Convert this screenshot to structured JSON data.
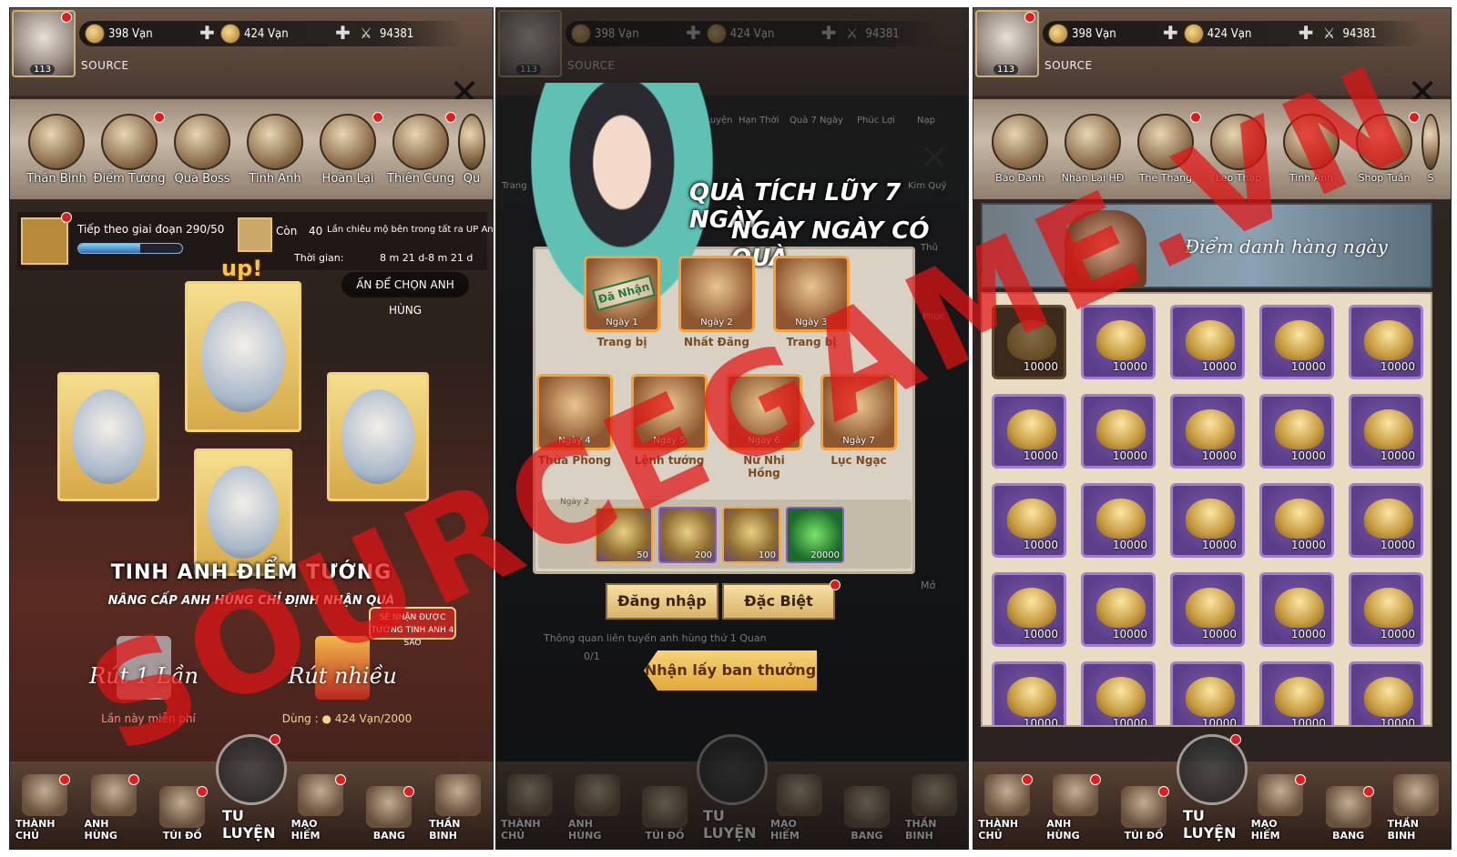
{
  "panels": {
    "common": {
      "resources": [
        {
          "value": "398 Vạn",
          "icon": "copper-coin-icon"
        },
        {
          "value": "424 Vạn",
          "icon": "gold-ingot-icon"
        },
        {
          "value": "94381",
          "icon": "crossed-swords-icon"
        }
      ],
      "level": "113",
      "source_label": "SOURCE",
      "bottom_nav": [
        "THÀNH CHỦ",
        "ANH HÙNG",
        "TÚI ĐỒ",
        "TU LUYỆN",
        "MẠO HIỂM",
        "BANG",
        "THẦN BINH"
      ]
    },
    "p1": {
      "tabs": [
        "Thần Binh",
        "Điểm Tướng",
        "Quà Boss",
        "Tinh Anh",
        "Hoàn Lại",
        "Thiên Cung",
        "Qu"
      ],
      "next_stage": "Tiếp theo giai đoạn 290/50",
      "remaining_label": "Còn",
      "remaining_value": "40",
      "remaining_desc": "Lần chiêu mộ bên trong tất ra UP Anh hùng",
      "time_label": "Thời gian:",
      "time_value": "8 m 21 d-8 m 21 d",
      "choose_hero": "ẤN ĐỂ CHỌN ANH HÙNG",
      "up_label": "up!",
      "title": "TINH ANH ĐIỂM TƯỚNG",
      "subtitle": "NÂNG CẤP ANH HÙNG CHỈ ĐỊNH NHẬN QUÀ",
      "badge": "SẼ NHẬN ĐƯỢC TƯỚNG TINH ANH 4 SAO",
      "draw_once": "Rút 1 Lần",
      "draw_once_sub": "Lần này miễn phí",
      "draw_many": "Rút nhiều",
      "draw_many_sub_label": "Dùng :",
      "draw_many_sub_value": "424 Vạn/2000",
      "progress": 0.6
    },
    "p2": {
      "title_line1": "QUÀ TÍCH LŨY 7 NGÀY",
      "title_line2": "NGÀY NGÀY CÓ QUÀ",
      "received_stamp": "Đã Nhận",
      "days": [
        {
          "day": "Ngày 1",
          "name": "Trang bị"
        },
        {
          "day": "Ngày 2",
          "name": "Nhất Đăng"
        },
        {
          "day": "Ngày 3",
          "name": "Trang bị"
        },
        {
          "day": "Ngày 4",
          "name": "Thừa Phong"
        },
        {
          "day": "Ngày 5",
          "name": "Lệnh tướng"
        },
        {
          "day": "Ngày 6",
          "name": "Nữ Nhi Hồng"
        },
        {
          "day": "Ngày 7",
          "name": "Lục Ngạc"
        }
      ],
      "tray_label": "Ngày 2",
      "tray_items": [
        "50",
        "200",
        "100",
        "20000"
      ],
      "btn_login": "Đăng nhập",
      "btn_special": "Đặc Biệt",
      "claim": "Nhận lấy ban thưởng",
      "ghost_quest": "Thông quan liên tuyến anh hùng thứ 1 Quan",
      "ghost_progress": "0/1",
      "ghost_mo": "Mở",
      "side_labels": [
        "Lịch Luyện",
        "Hạn Thời",
        "Quà 7 Ngày",
        "Phúc Lợi",
        "Nạp",
        "Kim Quỹ",
        "Trang",
        "Phúc",
        "Thủ"
      ]
    },
    "p3": {
      "tabs": [
        "Báo Danh",
        "Nhận Lại HĐ",
        "Thẻ Tháng",
        "Leo Tháp",
        "Tinh Anh",
        "Shop Tuần",
        "S"
      ],
      "banner": "Điểm danh hàng ngày",
      "cell_amount": "10000"
    }
  },
  "watermark": "SOURCEGAME.VN",
  "colors": {
    "accent_gold": "#f6a23c",
    "badge_red": "#e01d1d",
    "watermark": "#e11414",
    "cell_purple": "#a37bd3"
  }
}
